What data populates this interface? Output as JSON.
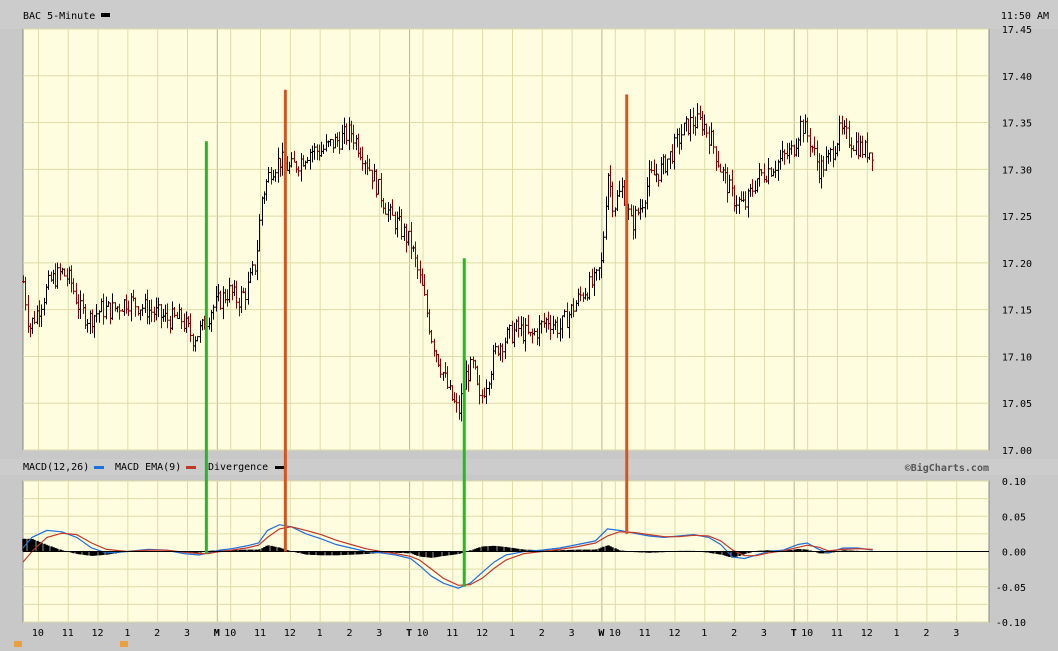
{
  "header": {
    "title": "BAC 5-Minute",
    "time": "11:50 AM"
  },
  "macd_header": {
    "macd_label": "MACD(12,26)",
    "ema_label": "MACD EMA(9)",
    "div_label": "Divergence",
    "credit": "©BigCharts.com"
  },
  "colors": {
    "plot_bg": "#fffde0",
    "panel_bg": "#cccccc",
    "grid": "#dcdca8",
    "candle_up": "#000000",
    "candle_down": "#8b0000",
    "macd_line": "#1f6fdc",
    "ema_line": "#c0392b",
    "divergence": "#000000",
    "green_marker": "#22bb22",
    "red_marker": "#d9531e"
  },
  "chart_data": [
    {
      "type": "candlestick",
      "title": "BAC 5-Minute",
      "y_ticks": [
        "17.45",
        "17.40",
        "17.35",
        "17.30",
        "17.25",
        "17.20",
        "17.15",
        "17.10",
        "17.05",
        "17.00"
      ],
      "ylim": [
        17.0,
        17.45
      ],
      "x_tick_labels": [
        "10",
        "11",
        "12",
        "1",
        "2",
        "3",
        "M",
        "10",
        "11",
        "12",
        "1",
        "2",
        "3",
        "T",
        "10",
        "11",
        "12",
        "1",
        "2",
        "3",
        "W",
        "10",
        "11",
        "12",
        "1",
        "2",
        "3",
        "T",
        "10",
        "11",
        "12",
        "1",
        "2",
        "3"
      ],
      "x_tick_positions": [
        0.5,
        1.5,
        2.5,
        3.5,
        4.5,
        5.5,
        6.5,
        6.95,
        7.95,
        8.95,
        9.95,
        10.95,
        11.95,
        12.95,
        13.4,
        14.4,
        15.4,
        16.4,
        17.4,
        18.4,
        19.4,
        19.85,
        20.85,
        21.85,
        22.85,
        23.85,
        24.85,
        25.85,
        26.3,
        27.3,
        28.3,
        29.3,
        30.3,
        31.3
      ],
      "xlim": [
        0,
        32.4
      ],
      "anchor_points": [
        [
          0.0,
          17.18
        ],
        [
          0.2,
          17.13
        ],
        [
          0.5,
          17.15
        ],
        [
          0.9,
          17.18
        ],
        [
          1.3,
          17.19
        ],
        [
          1.6,
          17.18
        ],
        [
          1.9,
          17.15
        ],
        [
          2.2,
          17.14
        ],
        [
          2.6,
          17.15
        ],
        [
          3.0,
          17.15
        ],
        [
          3.5,
          17.16
        ],
        [
          4.2,
          17.15
        ],
        [
          4.8,
          17.14
        ],
        [
          5.3,
          17.14
        ],
        [
          5.7,
          17.12
        ],
        [
          6.0,
          17.13
        ],
        [
          6.3,
          17.15
        ],
        [
          6.6,
          17.16
        ],
        [
          6.9,
          17.17
        ],
        [
          7.2,
          17.16
        ],
        [
          7.5,
          17.17
        ],
        [
          7.8,
          17.2
        ],
        [
          8.0,
          17.27
        ],
        [
          8.3,
          17.3
        ],
        [
          8.6,
          17.31
        ],
        [
          8.95,
          17.3
        ],
        [
          9.3,
          17.31
        ],
        [
          9.6,
          17.32
        ],
        [
          10.0,
          17.32
        ],
        [
          10.5,
          17.33
        ],
        [
          11.0,
          17.34
        ],
        [
          11.5,
          17.31
        ],
        [
          11.9,
          17.28
        ],
        [
          12.3,
          17.25
        ],
        [
          12.6,
          17.24
        ],
        [
          13.0,
          17.22
        ],
        [
          13.4,
          17.17
        ],
        [
          13.7,
          17.12
        ],
        [
          14.0,
          17.09
        ],
        [
          14.3,
          17.06
        ],
        [
          14.6,
          17.04
        ],
        [
          14.85,
          17.08
        ],
        [
          15.1,
          17.09
        ],
        [
          15.3,
          17.05
        ],
        [
          15.6,
          17.08
        ],
        [
          15.9,
          17.11
        ],
        [
          16.2,
          17.12
        ],
        [
          16.6,
          17.13
        ],
        [
          17.0,
          17.12
        ],
        [
          17.3,
          17.13
        ],
        [
          17.6,
          17.14
        ],
        [
          18.0,
          17.13
        ],
        [
          18.4,
          17.15
        ],
        [
          18.8,
          17.17
        ],
        [
          19.2,
          17.18
        ],
        [
          19.4,
          17.2
        ],
        [
          19.6,
          17.3
        ],
        [
          19.8,
          17.26
        ],
        [
          20.1,
          17.28
        ],
        [
          20.4,
          17.24
        ],
        [
          20.7,
          17.26
        ],
        [
          21.0,
          17.29
        ],
        [
          21.4,
          17.3
        ],
        [
          21.8,
          17.32
        ],
        [
          22.1,
          17.34
        ],
        [
          22.4,
          17.35
        ],
        [
          22.8,
          17.35
        ],
        [
          23.1,
          17.33
        ],
        [
          23.4,
          17.3
        ],
        [
          23.8,
          17.27
        ],
        [
          24.2,
          17.26
        ],
        [
          24.6,
          17.29
        ],
        [
          25.0,
          17.3
        ],
        [
          25.4,
          17.31
        ],
        [
          25.8,
          17.32
        ],
        [
          26.1,
          17.35
        ],
        [
          26.4,
          17.33
        ],
        [
          26.7,
          17.3
        ],
        [
          27.0,
          17.31
        ],
        [
          27.4,
          17.34
        ],
        [
          27.8,
          17.33
        ],
        [
          28.2,
          17.32
        ],
        [
          28.5,
          17.32
        ]
      ]
    },
    {
      "type": "line",
      "title": "MACD(12,26)",
      "y_ticks": [
        "0.10",
        "0.05",
        "0.00",
        "-0.05",
        "-0.10"
      ],
      "ylim": [
        -0.1,
        0.1
      ],
      "xlim": [
        0,
        32.4
      ],
      "series": [
        {
          "name": "MACD(12,26)",
          "color_key": "macd_line",
          "points": [
            [
              0.0,
              0.005
            ],
            [
              0.3,
              0.02
            ],
            [
              0.8,
              0.03
            ],
            [
              1.3,
              0.028
            ],
            [
              1.8,
              0.02
            ],
            [
              2.3,
              0.005
            ],
            [
              2.8,
              -0.002
            ],
            [
              3.5,
              0.0
            ],
            [
              4.2,
              0.003
            ],
            [
              4.8,
              0.002
            ],
            [
              5.4,
              -0.003
            ],
            [
              5.9,
              -0.005
            ],
            [
              6.2,
              -0.002
            ],
            [
              6.6,
              0.002
            ],
            [
              7.0,
              0.004
            ],
            [
              7.5,
              0.008
            ],
            [
              7.9,
              0.012
            ],
            [
              8.2,
              0.03
            ],
            [
              8.6,
              0.038
            ],
            [
              9.0,
              0.035
            ],
            [
              9.5,
              0.025
            ],
            [
              10.0,
              0.018
            ],
            [
              10.5,
              0.01
            ],
            [
              11.0,
              0.005
            ],
            [
              11.5,
              0.0
            ],
            [
              12.0,
              -0.002
            ],
            [
              12.5,
              -0.005
            ],
            [
              13.0,
              -0.01
            ],
            [
              13.3,
              -0.02
            ],
            [
              13.7,
              -0.035
            ],
            [
              14.1,
              -0.045
            ],
            [
              14.6,
              -0.052
            ],
            [
              15.0,
              -0.045
            ],
            [
              15.4,
              -0.03
            ],
            [
              15.8,
              -0.015
            ],
            [
              16.2,
              -0.005
            ],
            [
              16.8,
              0.0
            ],
            [
              17.4,
              0.002
            ],
            [
              18.0,
              0.005
            ],
            [
              18.6,
              0.01
            ],
            [
              19.2,
              0.015
            ],
            [
              19.6,
              0.032
            ],
            [
              20.0,
              0.03
            ],
            [
              20.5,
              0.026
            ],
            [
              21.0,
              0.022
            ],
            [
              21.5,
              0.02
            ],
            [
              22.0,
              0.022
            ],
            [
              22.5,
              0.024
            ],
            [
              23.0,
              0.02
            ],
            [
              23.4,
              0.01
            ],
            [
              23.8,
              -0.008
            ],
            [
              24.2,
              -0.01
            ],
            [
              24.6,
              -0.005
            ],
            [
              25.0,
              0.0
            ],
            [
              25.5,
              0.002
            ],
            [
              26.0,
              0.01
            ],
            [
              26.3,
              0.012
            ],
            [
              26.7,
              0.003
            ],
            [
              27.0,
              -0.002
            ],
            [
              27.5,
              0.005
            ],
            [
              28.0,
              0.005
            ],
            [
              28.5,
              0.002
            ]
          ]
        },
        {
          "name": "MACD EMA(9)",
          "color_key": "ema_line",
          "points": [
            [
              0.0,
              -0.015
            ],
            [
              0.3,
              0.0
            ],
            [
              0.8,
              0.02
            ],
            [
              1.3,
              0.026
            ],
            [
              1.8,
              0.024
            ],
            [
              2.3,
              0.012
            ],
            [
              2.8,
              0.003
            ],
            [
              3.5,
              0.0
            ],
            [
              4.2,
              0.002
            ],
            [
              4.8,
              0.002
            ],
            [
              5.4,
              -0.001
            ],
            [
              5.9,
              -0.003
            ],
            [
              6.2,
              -0.003
            ],
            [
              6.6,
              0.0
            ],
            [
              7.0,
              0.002
            ],
            [
              7.5,
              0.005
            ],
            [
              7.9,
              0.009
            ],
            [
              8.2,
              0.02
            ],
            [
              8.6,
              0.032
            ],
            [
              9.0,
              0.035
            ],
            [
              9.5,
              0.03
            ],
            [
              10.0,
              0.024
            ],
            [
              10.5,
              0.016
            ],
            [
              11.0,
              0.01
            ],
            [
              11.5,
              0.004
            ],
            [
              12.0,
              0.0
            ],
            [
              12.5,
              -0.003
            ],
            [
              13.0,
              -0.007
            ],
            [
              13.3,
              -0.012
            ],
            [
              13.7,
              -0.025
            ],
            [
              14.1,
              -0.038
            ],
            [
              14.6,
              -0.048
            ],
            [
              15.0,
              -0.047
            ],
            [
              15.4,
              -0.038
            ],
            [
              15.8,
              -0.024
            ],
            [
              16.2,
              -0.012
            ],
            [
              16.8,
              -0.003
            ],
            [
              17.4,
              0.0
            ],
            [
              18.0,
              0.003
            ],
            [
              18.6,
              0.007
            ],
            [
              19.2,
              0.012
            ],
            [
              19.6,
              0.022
            ],
            [
              20.0,
              0.028
            ],
            [
              20.5,
              0.027
            ],
            [
              21.0,
              0.024
            ],
            [
              21.5,
              0.021
            ],
            [
              22.0,
              0.021
            ],
            [
              22.5,
              0.023
            ],
            [
              23.0,
              0.022
            ],
            [
              23.4,
              0.015
            ],
            [
              23.8,
              0.002
            ],
            [
              24.2,
              -0.006
            ],
            [
              24.6,
              -0.006
            ],
            [
              25.0,
              -0.002
            ],
            [
              25.5,
              0.001
            ],
            [
              26.0,
              0.006
            ],
            [
              26.3,
              0.009
            ],
            [
              26.7,
              0.006
            ],
            [
              27.0,
              0.001
            ],
            [
              27.5,
              0.003
            ],
            [
              28.0,
              0.004
            ],
            [
              28.5,
              0.003
            ]
          ]
        }
      ]
    }
  ],
  "markers": [
    {
      "x": 6.15,
      "color_key": "green_marker",
      "price_top": 17.33
    },
    {
      "x": 8.8,
      "color_key": "red_marker",
      "price_top": 17.385
    },
    {
      "x": 14.8,
      "color_key": "green_marker",
      "price_top": 17.205
    },
    {
      "x": 20.25,
      "color_key": "red_marker",
      "price_top": 17.38
    }
  ]
}
